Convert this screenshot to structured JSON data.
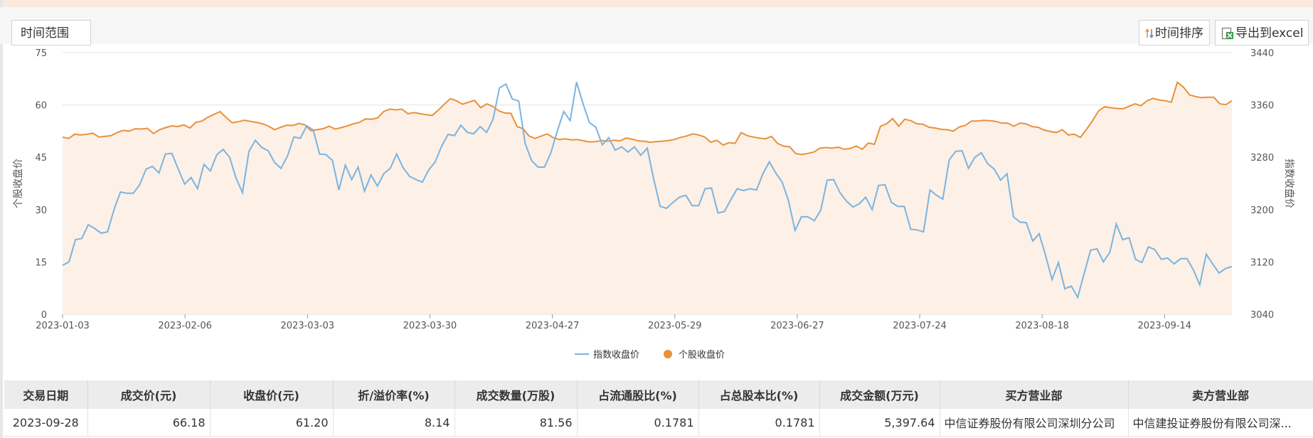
{
  "toolbar": {
    "range_label": "时间范围",
    "sort_label": "时间排序",
    "export_label": "导出到excel"
  },
  "colors": {
    "index_line": "#7ab4e0",
    "stock_line": "#e8913a",
    "area_fill": "#fdf0e6"
  },
  "chart_data": {
    "type": "line",
    "x_tick_labels": [
      "2023-01-03",
      "2023-02-06",
      "2023-03-03",
      "2023-03-30",
      "2023-04-27",
      "2023-05-29",
      "2023-06-27",
      "2023-07-24",
      "2023-08-18",
      "2023-09-14"
    ],
    "y_left": {
      "label": "个股收盘价",
      "range": [
        0,
        75
      ],
      "ticks": [
        0,
        15,
        30,
        45,
        60,
        75
      ]
    },
    "y_right": {
      "label": "指数收盘价",
      "range": [
        3040,
        3440
      ],
      "ticks": [
        3040,
        3120,
        3200,
        3280,
        3360,
        3440
      ]
    },
    "grid": true,
    "legend_position": "bottom-center",
    "series": [
      {
        "name": "指数收盘价",
        "axis": "right",
        "style": "line",
        "values": [
          3115,
          3120,
          3154,
          3156,
          3177,
          3171,
          3164,
          3166,
          3200,
          3227,
          3225,
          3225,
          3238,
          3262,
          3266,
          3256,
          3285,
          3286,
          3262,
          3239,
          3249,
          3232,
          3269,
          3259,
          3284,
          3292,
          3280,
          3248,
          3226,
          3289,
          3306,
          3295,
          3290,
          3272,
          3263,
          3282,
          3311,
          3309,
          3328,
          3322,
          3285,
          3284,
          3275,
          3230,
          3268,
          3246,
          3265,
          3228,
          3253,
          3236,
          3255,
          3263,
          3285,
          3264,
          3251,
          3246,
          3242,
          3261,
          3273,
          3297,
          3315,
          3313,
          3329,
          3318,
          3316,
          3327,
          3318,
          3338,
          3386,
          3392,
          3369,
          3366,
          3301,
          3275,
          3265,
          3265,
          3287,
          3320,
          3350,
          3336,
          3395,
          3362,
          3333,
          3326,
          3299,
          3310,
          3291,
          3296,
          3288,
          3296,
          3283,
          3294,
          3247,
          3205,
          3202,
          3211,
          3219,
          3222,
          3206,
          3206,
          3232,
          3233,
          3195,
          3197,
          3215,
          3232,
          3229,
          3232,
          3230,
          3255,
          3273,
          3256,
          3242,
          3213,
          3168,
          3189,
          3189,
          3183,
          3199,
          3245,
          3246,
          3226,
          3213,
          3204,
          3209,
          3219,
          3200,
          3237,
          3238,
          3211,
          3205,
          3205,
          3170,
          3169,
          3166,
          3230,
          3222,
          3216,
          3276,
          3289,
          3290,
          3263,
          3280,
          3287,
          3270,
          3262,
          3245,
          3255,
          3189,
          3181,
          3180,
          3152,
          3163,
          3130,
          3093,
          3119,
          3079,
          3083,
          3066,
          3102,
          3138,
          3140,
          3120,
          3135,
          3178,
          3154,
          3157,
          3124,
          3119,
          3143,
          3139,
          3124,
          3126,
          3117,
          3125,
          3125,
          3108,
          3085,
          3132,
          3117,
          3103,
          3110,
          3113
        ]
      },
      {
        "name": "个股收盘价",
        "axis": "left",
        "style": "area-line",
        "values": [
          50.8,
          50.4,
          51.6,
          51.4,
          51.6,
          51.9,
          50.8,
          51.0,
          51.2,
          52.1,
          52.7,
          52.5,
          53.2,
          53.1,
          53.3,
          51.8,
          52.9,
          53.5,
          54.0,
          53.8,
          54.3,
          53.4,
          55.0,
          55.4,
          56.5,
          57.3,
          58.1,
          56.4,
          54.9,
          55.2,
          55.6,
          55.3,
          55.0,
          54.6,
          53.9,
          52.9,
          53.6,
          54.2,
          54.1,
          54.7,
          54.3,
          52.6,
          52.9,
          53.2,
          53.9,
          53.1,
          53.5,
          54.0,
          54.6,
          55.0,
          56.0,
          55.9,
          56.3,
          58.1,
          58.8,
          58.6,
          58.8,
          57.5,
          57.8,
          57.5,
          57.2,
          57.0,
          58.5,
          60.2,
          61.8,
          61.2,
          60.2,
          60.8,
          61.3,
          59.2,
          60.3,
          59.6,
          58.3,
          57.7,
          57.6,
          53.8,
          53.2,
          51.1,
          50.4,
          51.1,
          51.7,
          50.6,
          50.1,
          50.3,
          50.0,
          50.1,
          49.7,
          49.4,
          49.5,
          49.8,
          49.6,
          49.9,
          49.7,
          50.5,
          50.2,
          49.7,
          49.6,
          49.3,
          49.5,
          49.6,
          49.8,
          50.1,
          50.7,
          51.1,
          51.7,
          51.4,
          50.8,
          49.3,
          49.9,
          48.5,
          49.2,
          49.0,
          52.1,
          51.2,
          50.8,
          50.5,
          50.3,
          51.0,
          49.0,
          48.2,
          48.0,
          46.1,
          45.8,
          46.1,
          46.5,
          47.6,
          47.8,
          47.6,
          47.9,
          47.3,
          47.5,
          48.2,
          47.3,
          49.1,
          48.7,
          53.9,
          54.6,
          56.1,
          53.9,
          55.9,
          55.5,
          54.6,
          54.5,
          53.6,
          53.4,
          53.0,
          52.9,
          52.5,
          53.7,
          54.1,
          55.4,
          55.4,
          55.6,
          55.5,
          55.3,
          54.8,
          54.8,
          53.9,
          54.8,
          54.6,
          53.8,
          53.6,
          52.8,
          52.4,
          52.1,
          52.9,
          51.4,
          51.6,
          50.7,
          53.0,
          55.5,
          58.3,
          59.5,
          59.2,
          59.0,
          58.9,
          59.6,
          60.3,
          59.8,
          61.2,
          61.9,
          61.4,
          61.2,
          60.8,
          66.5,
          65.1,
          62.9,
          62.4,
          62.1,
          62.2,
          62.2,
          60.3,
          60.1,
          61.2
        ]
      }
    ]
  },
  "table": {
    "headers": [
      "交易日期",
      "成交价(元)",
      "收盘价(元)",
      "折/溢价率(%)",
      "成交数量(万股)",
      "占流通股比(%)",
      "占总股本比(%)",
      "成交金额(万元)",
      "买方营业部",
      "卖方营业部"
    ],
    "rows": [
      [
        "2023-09-28",
        "66.18",
        "61.20",
        "8.14",
        "81.56",
        "0.1781",
        "0.1781",
        "5,397.64",
        "中信证券股份有限公司深圳分公司",
        "中信建投证券股份有限公司深..."
      ]
    ]
  }
}
